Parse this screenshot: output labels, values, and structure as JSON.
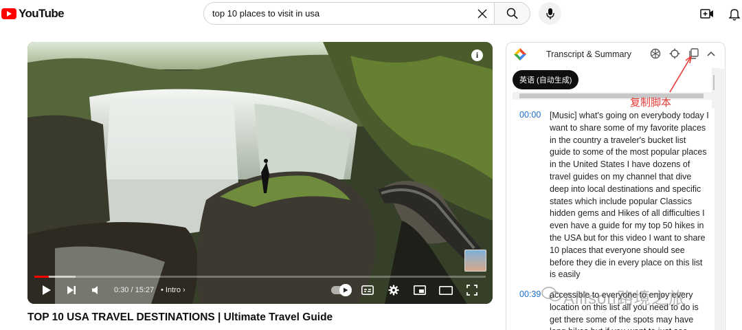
{
  "header": {
    "logo_text": "YouTube",
    "search_value": "top 10 places to visit in usa"
  },
  "video": {
    "time": "0:30 / 15:27",
    "chapter": "Intro",
    "progress_fraction": 0.032,
    "title": "TOP 10 USA TRAVEL DESTINATIONS | Ultimate Travel Guide"
  },
  "transcript": {
    "panel_title": "Transcript & Summary",
    "language": "英语 (自动生成)",
    "annotation": "复制脚本",
    "segments": [
      {
        "time": "00:00",
        "text": "[Music] what's going on everybody today I want to share some of my favorite places in the country a traveler's bucket list guide to some of the most popular places in the United States I have dozens of travel guides on my channel that dive deep into local destinations and specific states which include popular Classics hidden gems and Hikes of all difficulties I even have a guide for my top 50 hikes in the USA but for this video I want to share 10 places that everyone should see before they die in every place on this list is easily"
      },
      {
        "time": "00:39",
        "text": "accessible to everyone to enjoy every location on this list all you need to do is get there some of the spots may have long hikes but if you want to just see"
      }
    ]
  },
  "watermark": "Allison路境之旅"
}
